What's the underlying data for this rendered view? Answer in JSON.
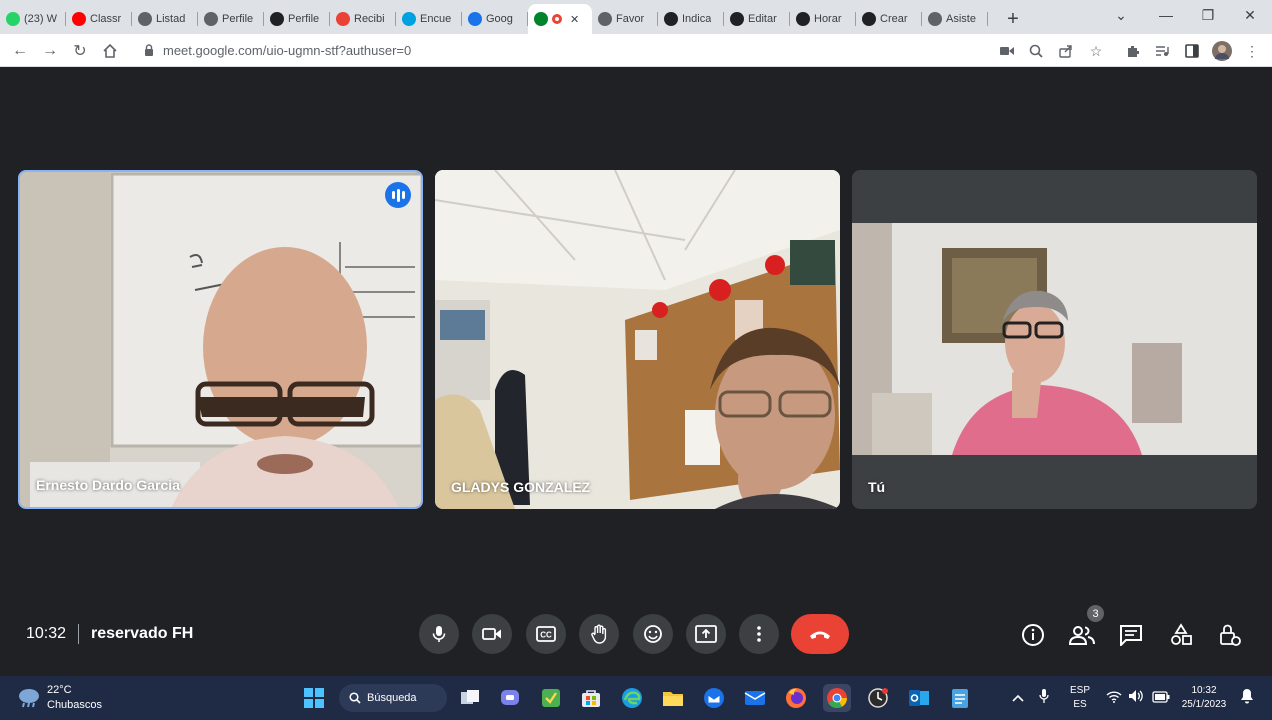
{
  "browser": {
    "tabs": [
      {
        "label": "(23) W",
        "icon": "whatsapp-icon",
        "color": "#25d366"
      },
      {
        "label": "Classr",
        "icon": "youtube-icon",
        "color": "#ff0000"
      },
      {
        "label": "Listad",
        "icon": "globe-icon",
        "color": "#5f6368"
      },
      {
        "label": "Perfile",
        "icon": "globe-icon",
        "color": "#5f6368"
      },
      {
        "label": "Perfile",
        "icon": "app-icon",
        "color": "#202124"
      },
      {
        "label": "Recibi",
        "icon": "gmail-icon",
        "color": "#ea4335"
      },
      {
        "label": "Encue",
        "icon": "cloud-icon",
        "color": "#00a1e0"
      },
      {
        "label": "Goog",
        "icon": "classroom-icon",
        "color": "#1a73e8"
      },
      {
        "label": "",
        "icon": "meet-icon",
        "color": "#00832d",
        "active": true
      },
      {
        "label": "Favor",
        "icon": "globe-icon",
        "color": "#5f6368"
      },
      {
        "label": "Indica",
        "icon": "app-icon",
        "color": "#202124"
      },
      {
        "label": "Editar",
        "icon": "app-icon",
        "color": "#202124"
      },
      {
        "label": "Horar",
        "icon": "app-icon",
        "color": "#202124"
      },
      {
        "label": "Crear",
        "icon": "app-icon",
        "color": "#202124"
      },
      {
        "label": "Asiste",
        "icon": "globe-icon",
        "color": "#5f6368"
      }
    ],
    "url": "meet.google.com/uio-ugmn-stf?authuser=0"
  },
  "meet": {
    "participants": [
      {
        "name": "Ernesto Dardo Garcia",
        "speaking": true
      },
      {
        "name": "GLADYS GONZALEZ",
        "speaking": false
      },
      {
        "name": "Tú",
        "speaking": false
      }
    ],
    "time": "10:32",
    "meeting_name": "reservado FH",
    "participant_count": "3",
    "colors": {
      "end_call": "#ea4335",
      "speaking": "#1a73e8",
      "active_border": "#8ab4f8"
    }
  },
  "taskbar": {
    "weather_temp": "22°C",
    "weather_cond": "Chubascos",
    "search_label": "Búsqueda",
    "lang_top": "ESP",
    "lang_bottom": "ES",
    "time": "10:32",
    "date": "25/1/2023"
  }
}
